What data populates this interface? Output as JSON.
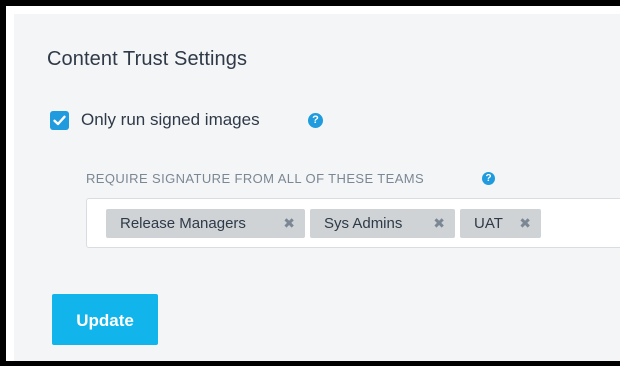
{
  "section": {
    "title": "Content Trust Settings"
  },
  "signed_images": {
    "checked": true,
    "label": "Only run signed images",
    "help_icon": "question-circle-icon",
    "check_icon": "checkmark-icon"
  },
  "teams": {
    "label": "REQUIRE SIGNATURE FROM ALL OF THESE TEAMS",
    "help_icon": "question-circle-icon",
    "tags": [
      {
        "label": "Release Managers",
        "remove_icon": "close-icon"
      },
      {
        "label": "Sys Admins",
        "remove_icon": "close-icon"
      },
      {
        "label": "UAT",
        "remove_icon": "close-icon"
      }
    ]
  },
  "actions": {
    "update_label": "Update"
  },
  "colors": {
    "accent": "#1f9bde",
    "button": "#11b5ec",
    "panel_background": "#f4f5f6",
    "tag_background": "#cfd3d6",
    "text": "#2f3a48",
    "muted_text": "#7b8794"
  }
}
